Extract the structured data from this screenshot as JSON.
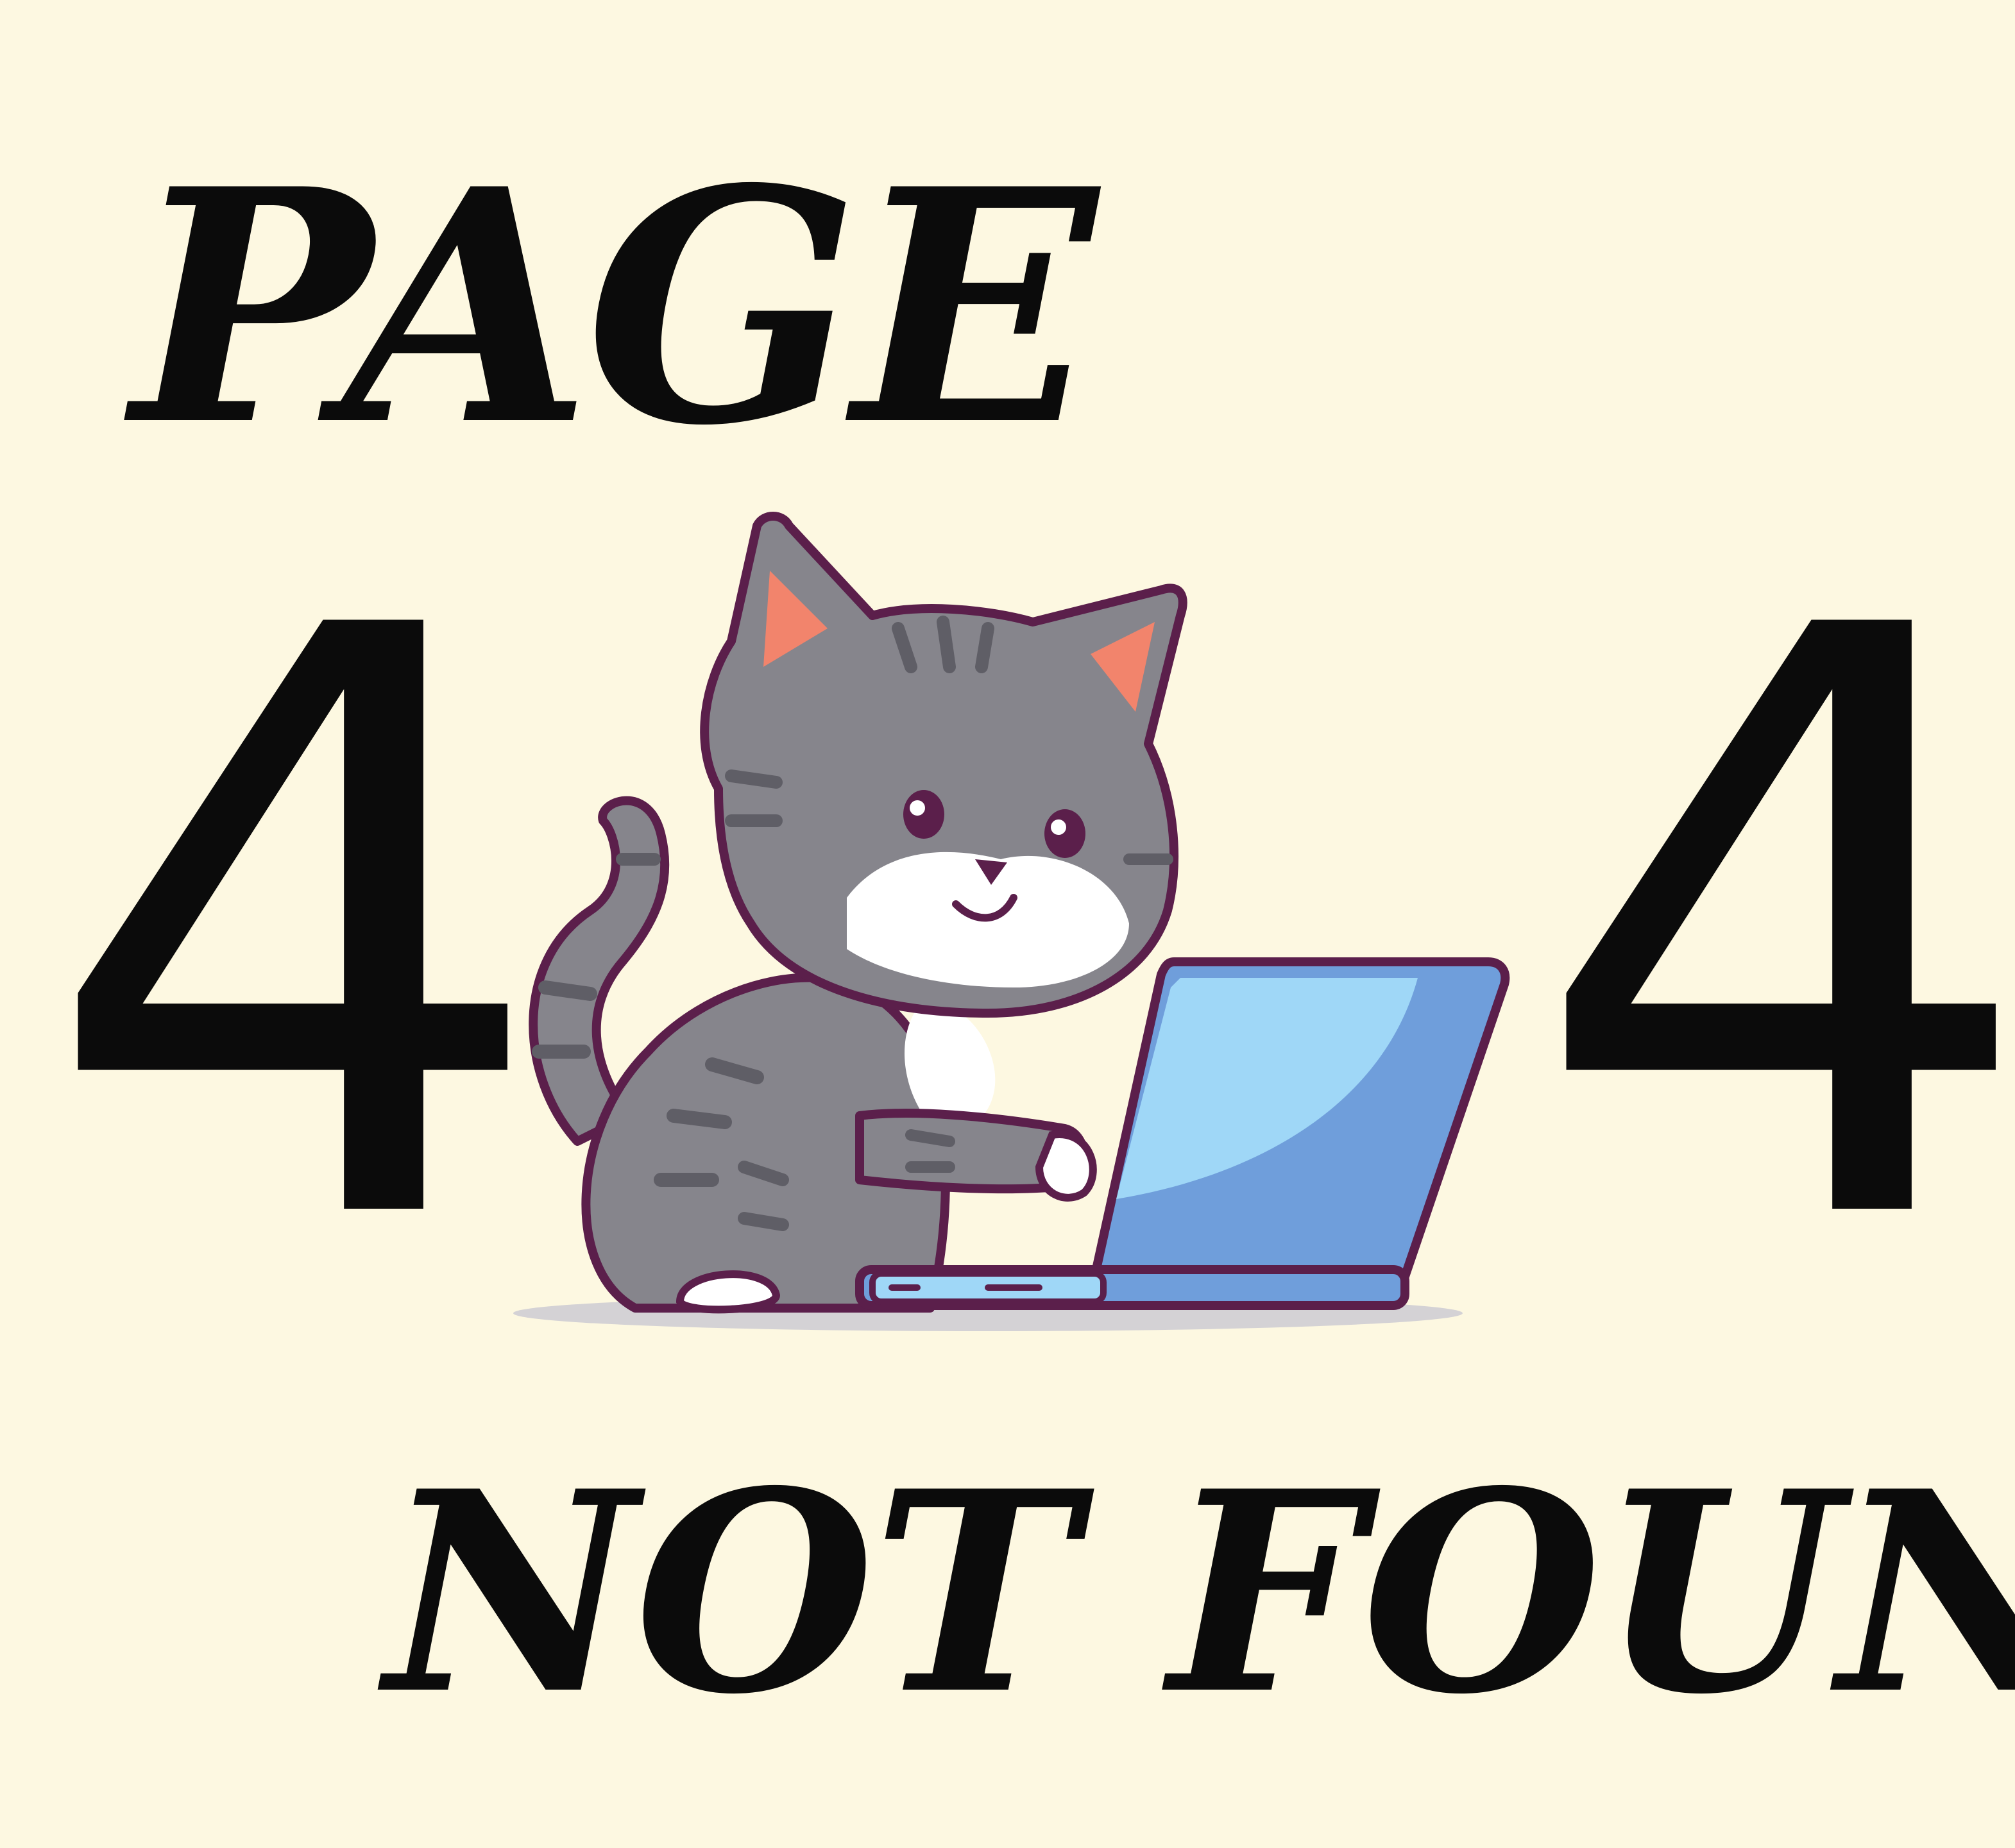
{
  "heading_top": "PAGE",
  "digit_left": "4",
  "digit_right": "4",
  "heading_bottom": "NOT FOUND",
  "colors": {
    "background": "#fdf8e1",
    "text": "#0b0b0b",
    "cat_fur": "#86858c",
    "cat_stripes": "#5f5e66",
    "cat_outline": "#5b1f4b",
    "cat_white": "#ffffff",
    "ear_inner": "#f2846c",
    "laptop_screen": "#9fd7f7",
    "laptop_body": "#6f9edb",
    "shadow": "#c9c8d2"
  },
  "illustration": {
    "cat_icon": "cat-icon",
    "laptop_icon": "laptop-icon"
  }
}
